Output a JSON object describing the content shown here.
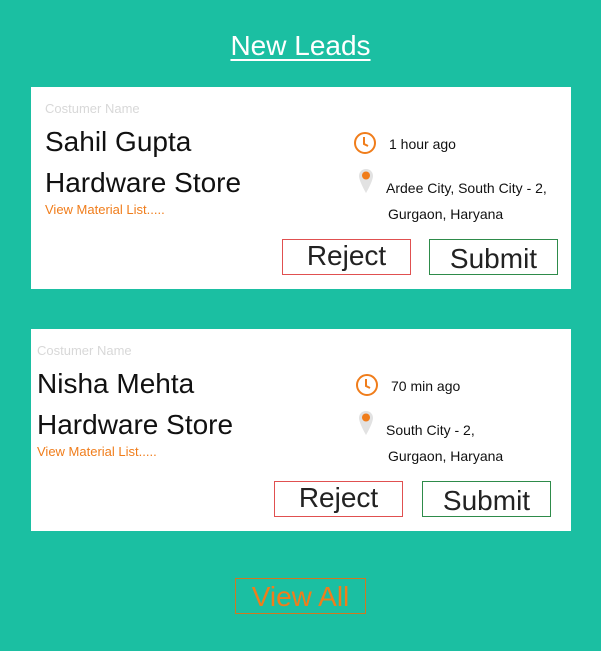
{
  "page": {
    "title": "New Leads"
  },
  "leads": [
    {
      "label": "Costumer Name",
      "name_line1": "Sahil Gupta",
      "name_line2": "Hardware Store",
      "material_link": "View Material List.....",
      "time": "1 hour ago",
      "address_line1": "Ardee City, South City - 2,",
      "address_line2": "Gurgaon, Haryana",
      "reject_label": "Reject",
      "submit_label": "Submit"
    },
    {
      "label": "Costumer Name",
      "name_line1": "Nisha Mehta",
      "name_line2": "Hardware Store",
      "material_link": "View Material List.....",
      "time": "70 min ago",
      "address_line1": "South City - 2,",
      "address_line2": "Gurgaon, Haryana",
      "reject_label": "Reject",
      "submit_label": "Submit"
    }
  ],
  "footer": {
    "view_all_label": "View All"
  },
  "colors": {
    "background": "#1bbfa2",
    "accent": "#f07d1b",
    "reject_border": "#e05050",
    "submit_border": "#2e8b4a"
  },
  "icons": {
    "time": "clock-icon",
    "location": "location-pin-icon"
  }
}
